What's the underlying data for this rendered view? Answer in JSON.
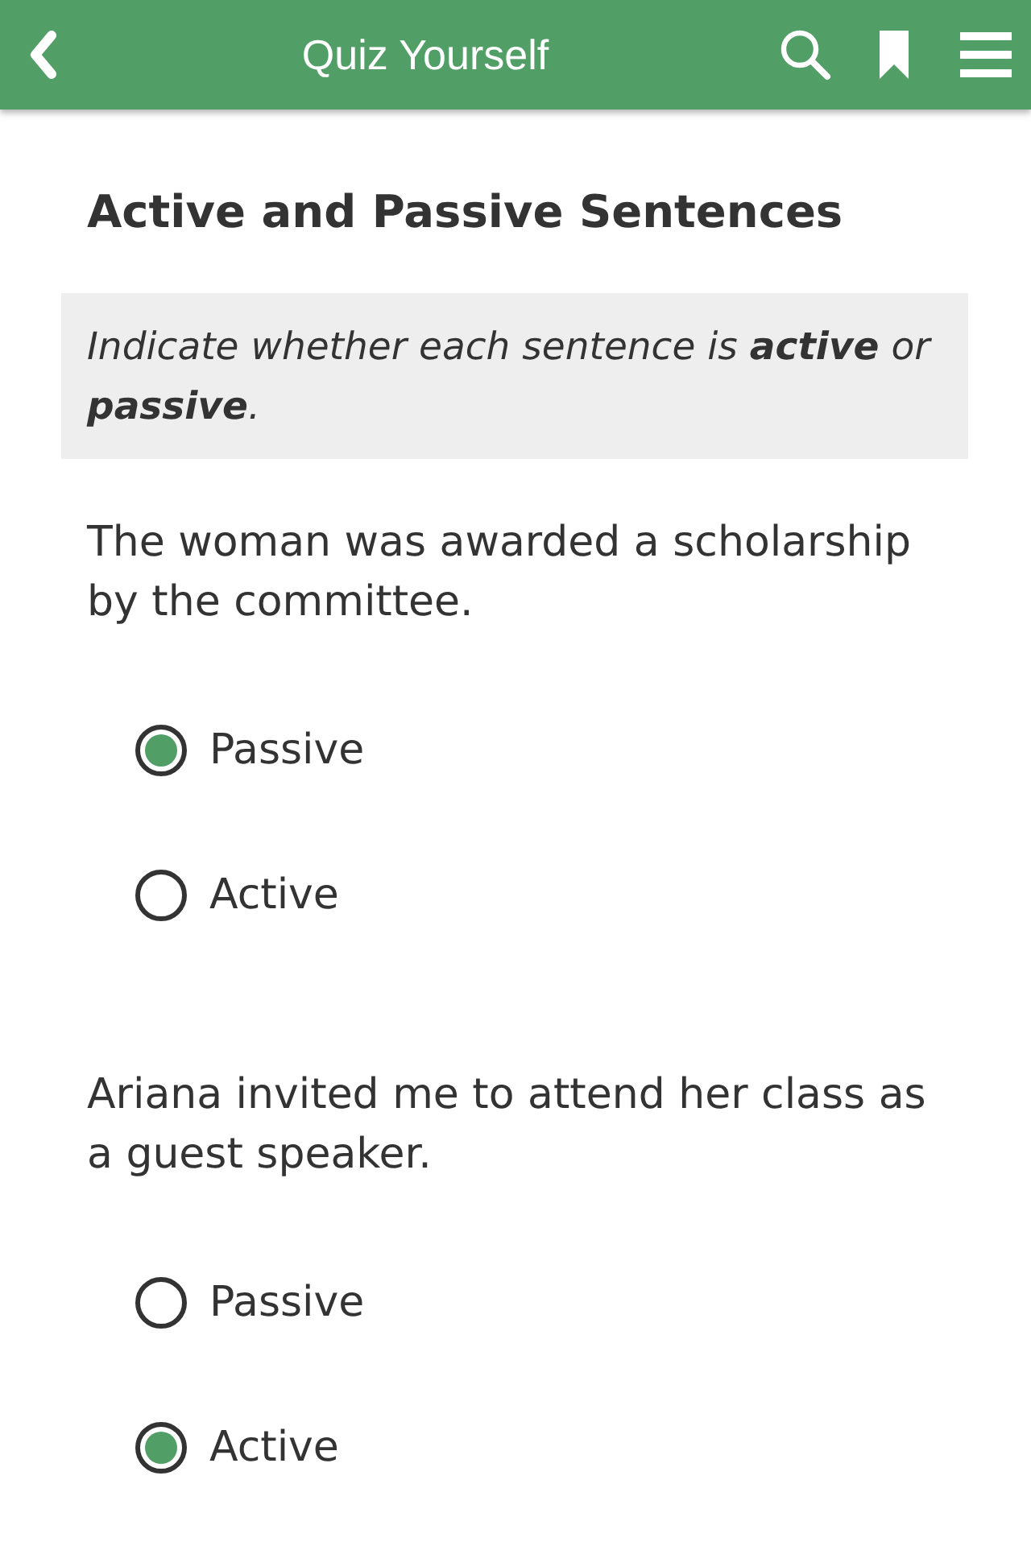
{
  "header": {
    "title": "Quiz Yourself"
  },
  "page": {
    "heading": "Active and Passive Sentences",
    "instruction": "Indicate whether each sentence is **active** or **passive**."
  },
  "questions": [
    {
      "text": "The woman was awarded a scholarship by the committee.",
      "options": [
        {
          "label": "Passive",
          "selected": true
        },
        {
          "label": "Active",
          "selected": false
        }
      ]
    },
    {
      "text": "Ariana invited me to attend her class as a guest speaker.",
      "options": [
        {
          "label": "Passive",
          "selected": false
        },
        {
          "label": "Active",
          "selected": true
        }
      ]
    }
  ]
}
